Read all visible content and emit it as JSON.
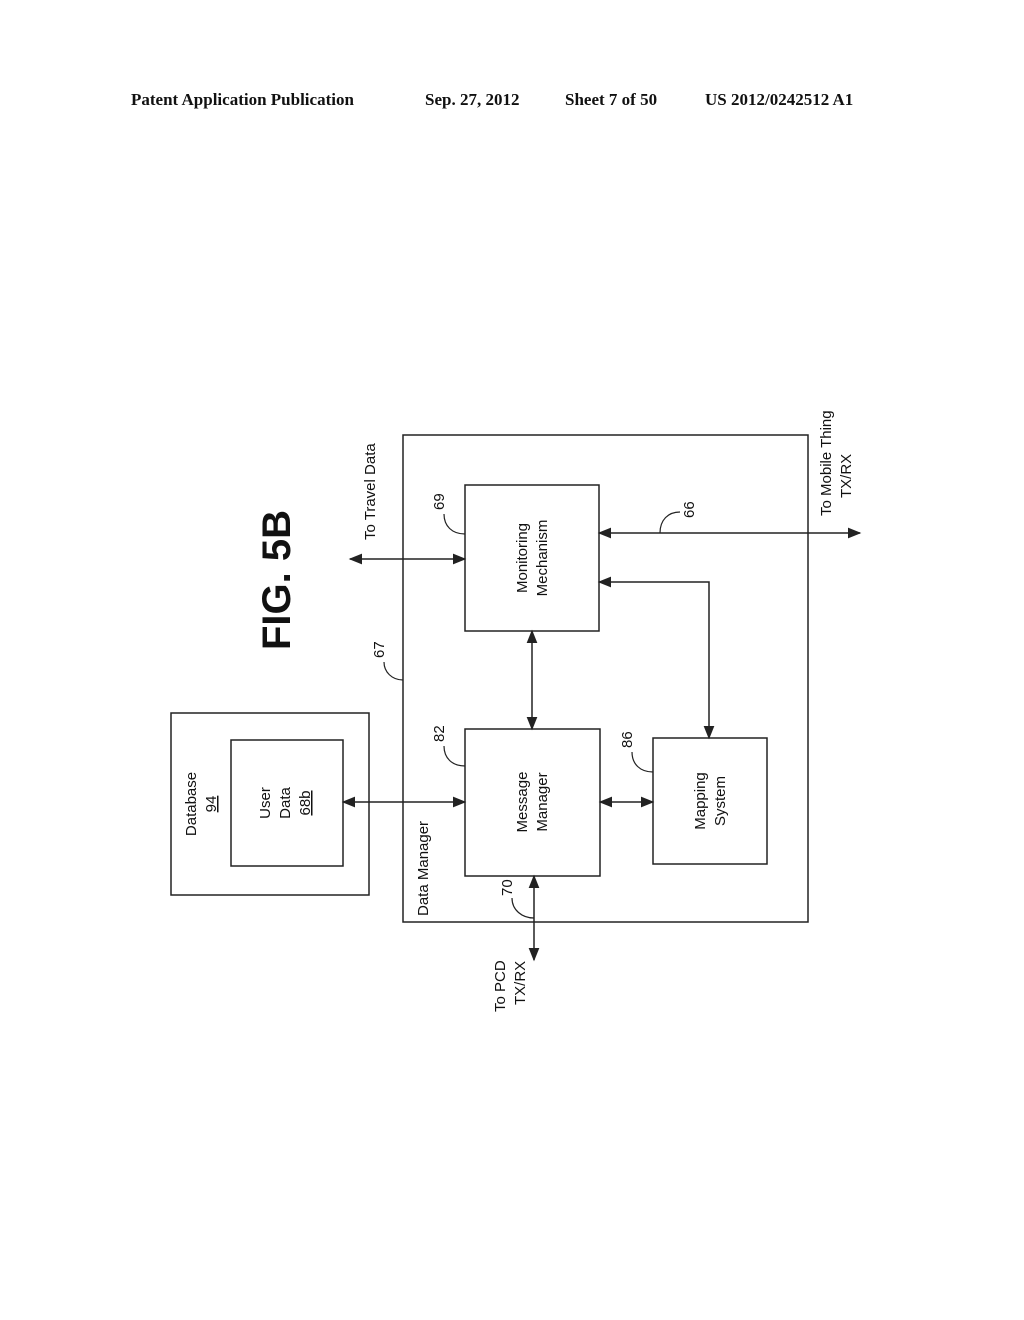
{
  "header": {
    "publication": "Patent Application Publication",
    "date": "Sep. 27, 2012",
    "sheet": "Sheet 7 of 50",
    "number": "US 2012/0242512 A1"
  },
  "figure": {
    "title": "FIG. 5B",
    "container": {
      "label": "Data Manager",
      "ref": "67"
    },
    "database": {
      "label": "Database",
      "ref": "94"
    },
    "user_data": {
      "line1": "User",
      "line2": "Data",
      "ref": "68b"
    },
    "monitoring": {
      "line1": "Monitoring",
      "line2": "Mechanism",
      "ref": "69"
    },
    "message_manager": {
      "line1": "Message",
      "line2": "Manager",
      "ref": "82"
    },
    "mapping": {
      "line1": "Mapping",
      "line2": "System",
      "ref": "86"
    },
    "travel_data": {
      "label": "To Travel Data"
    },
    "mobile": {
      "line1": "To Mobile Thing",
      "line2": "TX/RX",
      "ref": "66"
    },
    "pcd": {
      "line1": "To PCD",
      "line2": "TX/RX",
      "ref": "70"
    }
  }
}
